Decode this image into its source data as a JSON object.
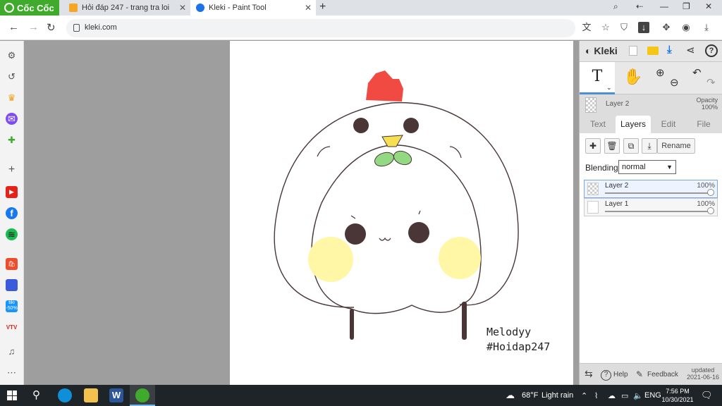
{
  "browser": {
    "brand_label": "Cốc Cốc",
    "tabs": [
      {
        "title": "Hỏi đáp 247 - trang tra loi",
        "active": false,
        "fav_color": "#f5a623"
      },
      {
        "title": "Kleki - Paint Tool",
        "active": true,
        "fav_color": "#1a73e8"
      }
    ],
    "url": "kleki.com"
  },
  "canvas": {
    "signature_name": "Melodyy",
    "signature_tag": "#Hoidap247"
  },
  "kleki": {
    "logo": "Kleki",
    "active_tool": "T",
    "current_layer": "Layer 2",
    "opacity_label": "Opacity",
    "opacity_value": "100%",
    "tabs": [
      "Text",
      "Layers",
      "Edit",
      "File"
    ],
    "active_tab": "Layers",
    "rename_label": "Rename",
    "blending_label": "Blending",
    "blending_value": "normal",
    "layers": [
      {
        "name": "Layer 2",
        "opacity": "100%",
        "selected": true
      },
      {
        "name": "Layer 1",
        "opacity": "100%",
        "selected": false
      }
    ],
    "footer": {
      "help": "Help",
      "feedback": "Feedback",
      "updated_label": "updated",
      "updated_date": "2021-06-16"
    }
  },
  "taskbar": {
    "temperature": "68°F",
    "weather": "Light rain",
    "language": "ENG",
    "time": "7:56 PM",
    "date": "10/30/2021"
  },
  "colors": {
    "browser_brand": "#3faa2b",
    "canvas_bg": "#9e9e9e",
    "accent_blue": "#1a73e8",
    "comb_red": "#f04a42",
    "beak_yellow": "#f7df53",
    "leaf_green": "#93d882",
    "cheek_yellow": "#fff6a6",
    "line_brown": "#4a3636"
  }
}
